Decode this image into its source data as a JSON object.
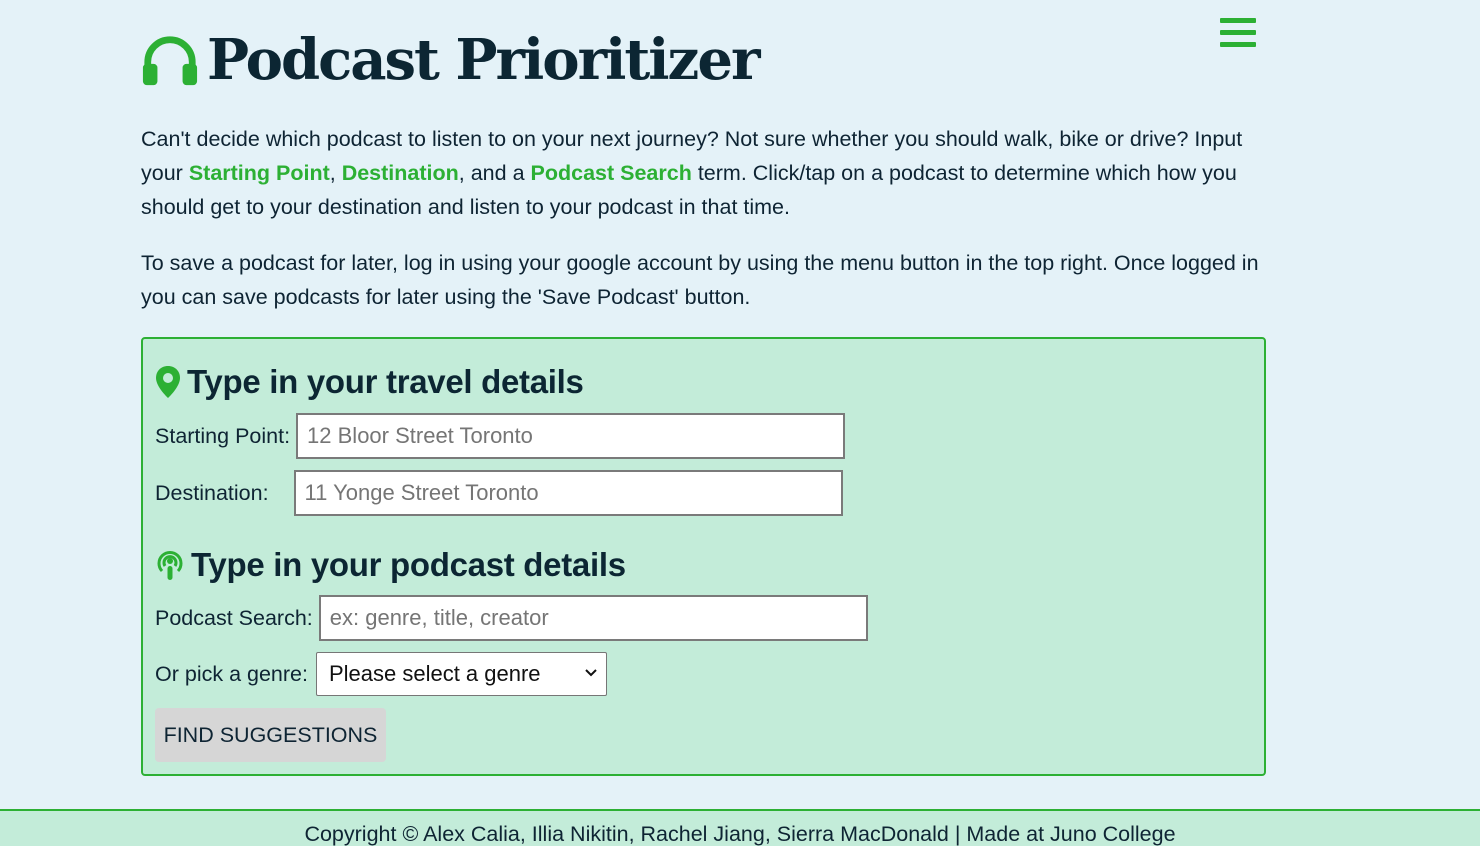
{
  "app": {
    "title": "Podcast Prioritizer"
  },
  "intro": {
    "p1_a": "Can't decide which podcast to listen to on your next journey? Not sure whether you should walk, bike or drive? Input your ",
    "p1_start": "Starting Point",
    "p1_sep1": ", ",
    "p1_dest": "Destination",
    "p1_sep2": ", and a ",
    "p1_search": "Podcast Search",
    "p1_b": " term. Click/tap on a podcast to determine which how you should get to your destination and listen to your podcast in that time.",
    "p2": "To save a podcast for later, log in using your google account by using the menu button in the top right. Once logged in you can save podcasts for later using the 'Save Podcast' button."
  },
  "travel": {
    "heading": "Type in your travel details",
    "start_label": "Starting Point:",
    "start_placeholder": "12 Bloor Street Toronto",
    "dest_label": "Destination:",
    "dest_placeholder": "11 Yonge Street Toronto"
  },
  "podcast": {
    "heading": "Type in your podcast details",
    "search_label": "Podcast Search:",
    "search_placeholder": "ex: genre, title, creator",
    "genre_label": "Or pick a genre:",
    "genre_selected": "Please select a genre"
  },
  "find_button": "FIND SUGGESTIONS",
  "footer": "Copyright © Alex Calia, Illia Nikitin, Rachel Jiang, Sierra MacDonald | Made at Juno College",
  "icons": {
    "logo": "headphones-icon",
    "menu": "hamburger-menu-icon",
    "travel": "map-marker-icon",
    "podcast": "podcast-icon",
    "select": "chevron-down-icon"
  },
  "colors": {
    "accent": "#2cb034",
    "background": "#e4f2f8",
    "panel": "#c3ecd9",
    "text": "#0e2433"
  }
}
